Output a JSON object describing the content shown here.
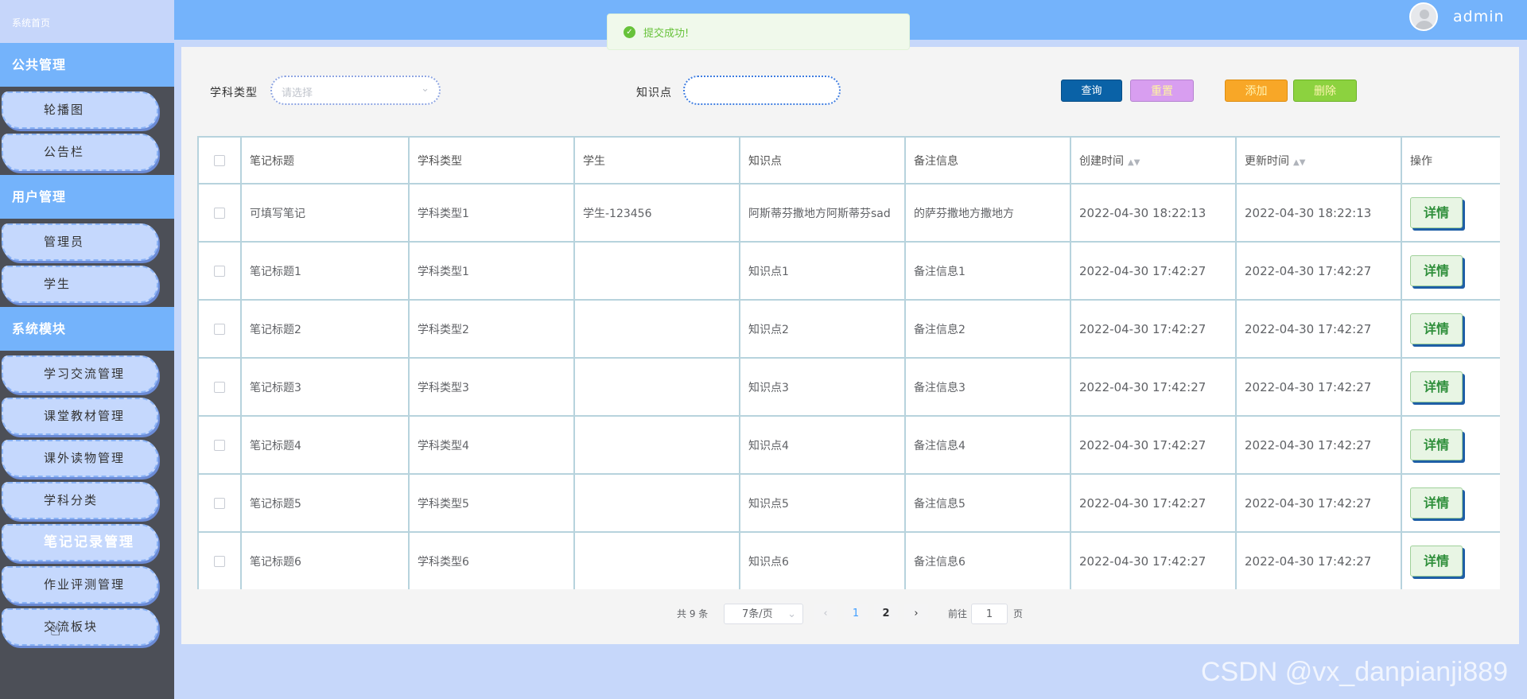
{
  "brand": "系统首页",
  "topbar": {
    "faint_title": "",
    "username": "admin"
  },
  "toast": {
    "message": "提交成功!"
  },
  "sidebar": {
    "groups": [
      {
        "title": "公共管理",
        "items": [
          "轮播图",
          "公告栏"
        ]
      },
      {
        "title": "用户管理",
        "items": [
          "管理员",
          "学生"
        ]
      },
      {
        "title": "系统模块",
        "items": [
          "学习交流管理",
          "课堂教材管理",
          "课外读物管理",
          "学科分类",
          "笔记记录管理",
          "作业评测管理",
          "交流板块"
        ]
      }
    ],
    "active_item": "笔记记录管理"
  },
  "search": {
    "subject_label": "学科类型",
    "subject_placeholder": "请选择",
    "knowledge_label": "知识点",
    "knowledge_value": ""
  },
  "toolbar": {
    "query": "查询",
    "reset": "重置",
    "add": "添加",
    "delete": "删除"
  },
  "table": {
    "headers": [
      "笔记标题",
      "学科类型",
      "学生",
      "知识点",
      "备注信息",
      "创建时间",
      "更新时间",
      "操作"
    ],
    "rows": [
      [
        "可填写笔记",
        "学科类型1",
        "学生-123456",
        "阿斯蒂芬撒地方阿斯蒂芬sad",
        "的萨芬撒地方撒地方",
        "2022-04-30 18:22:13",
        "2022-04-30 18:22:13"
      ],
      [
        "笔记标题1",
        "学科类型1",
        "",
        "知识点1",
        "备注信息1",
        "2022-04-30 17:42:27",
        "2022-04-30 17:42:27"
      ],
      [
        "笔记标题2",
        "学科类型2",
        "",
        "知识点2",
        "备注信息2",
        "2022-04-30 17:42:27",
        "2022-04-30 17:42:27"
      ],
      [
        "笔记标题3",
        "学科类型3",
        "",
        "知识点3",
        "备注信息3",
        "2022-04-30 17:42:27",
        "2022-04-30 17:42:27"
      ],
      [
        "笔记标题4",
        "学科类型4",
        "",
        "知识点4",
        "备注信息4",
        "2022-04-30 17:42:27",
        "2022-04-30 17:42:27"
      ],
      [
        "笔记标题5",
        "学科类型5",
        "",
        "知识点5",
        "备注信息5",
        "2022-04-30 17:42:27",
        "2022-04-30 17:42:27"
      ],
      [
        "笔记标题6",
        "学科类型6",
        "",
        "知识点6",
        "备注信息6",
        "2022-04-30 17:42:27",
        "2022-04-30 17:42:27"
      ]
    ],
    "detail_label": "详情"
  },
  "pagination": {
    "total_text": "共 9 条",
    "page_size": "7条/页",
    "pages": [
      "1",
      "2"
    ],
    "current_page": "1",
    "goto_label": "前往",
    "goto_value": "1",
    "unit": "页"
  },
  "watermark": "CSDN @vx_danpianji889",
  "colors": {
    "topbar": "#74b3fb",
    "sidebar_bg": "#4c4f57",
    "menu_item_bg": "#c5d8fd",
    "query_btn": "#0a62a7",
    "reset_btn": "#d89ef0",
    "add_btn": "#f8a727",
    "delete_btn": "#8cd23f",
    "table_border": "#b7d3dd"
  },
  "icons": {
    "toast": "check-circle-icon",
    "avatar": "user-avatar-icon",
    "select": "chevron-down-icon",
    "sort": "sort-icon",
    "prev": "chevron-left-icon",
    "next": "chevron-right-icon",
    "cursor": "hand-pointer-icon"
  }
}
